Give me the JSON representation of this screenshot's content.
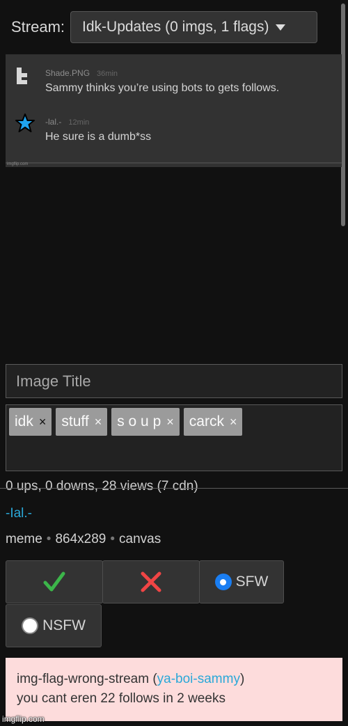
{
  "stream": {
    "label": "Stream:",
    "selected": "Idk-Updates (0 imgs, 1 flags)",
    "icon": "caret-down-icon"
  },
  "preview": {
    "messages": [
      {
        "user": "Shade.PNG",
        "time": "36min",
        "text": "Sammy thinks you’re using bots to gets follows.",
        "avatar": "t-logo-icon"
      },
      {
        "user": "-lal.-",
        "time": "12min",
        "text": "He sure is a dumb*ss",
        "avatar": "blue-star-icon"
      }
    ],
    "watermark": "imgflip.com"
  },
  "title_input": {
    "placeholder": "Image Title",
    "value": ""
  },
  "tags": [
    {
      "label": "idk",
      "remove": "×"
    },
    {
      "label": "stuff",
      "remove": "×"
    },
    {
      "label": "s o u p",
      "remove": "×"
    },
    {
      "label": "carck",
      "remove": "×"
    }
  ],
  "stats": "0 ups, 0 downs, 28 views (7 cdn)",
  "author": "-Ial.-",
  "info": {
    "type": "meme",
    "dimensions": "864x289",
    "source": "canvas",
    "separator": "•"
  },
  "actions": {
    "approve_icon": "checkmark-icon",
    "reject_icon": "x-icon",
    "sfw_label": "SFW",
    "nsfw_label": "NSFW",
    "sfw_selected": true,
    "approve_color": "#3cb54a",
    "reject_color": "#f04545",
    "radio_color": "#1a7ef2"
  },
  "flag": {
    "type": "img-flag-wrong-stream",
    "open_paren": " (",
    "user": "ya-boi-sammy",
    "close_paren": ")",
    "message": "you cant eren 22 follows in 2 weeks",
    "background": "#fddcdc"
  },
  "watermark": "imgflip.com"
}
